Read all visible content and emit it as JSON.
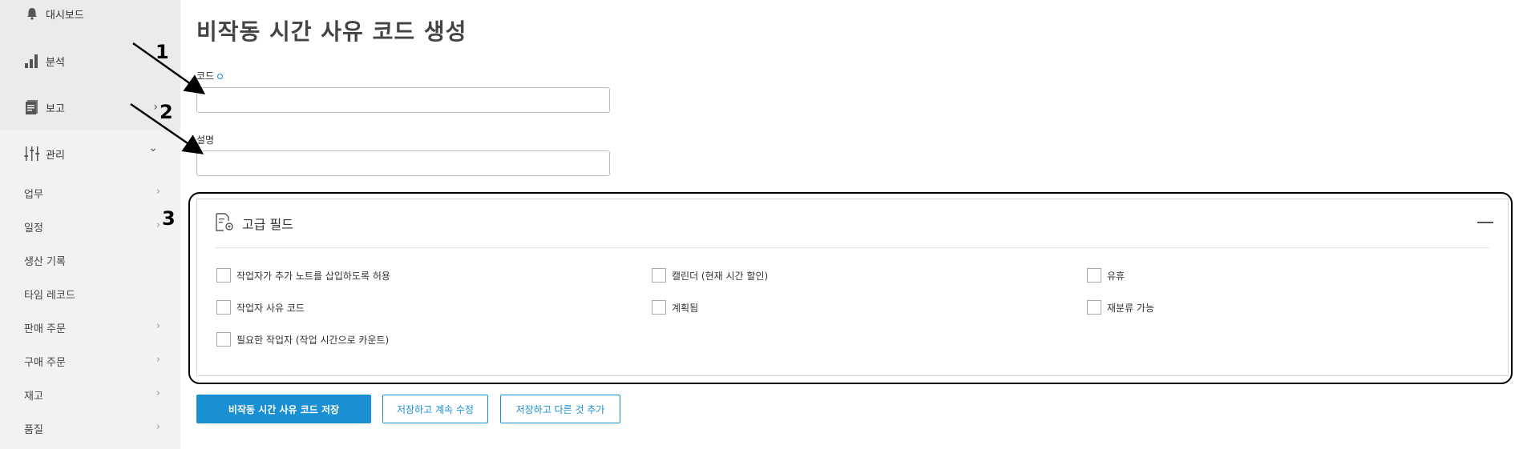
{
  "sidebar": {
    "items": [
      {
        "label": "대시보드",
        "icon": "bell-icon"
      },
      {
        "label": "분석",
        "icon": "bar-chart-icon"
      },
      {
        "label": "보고",
        "icon": "report-icon"
      },
      {
        "label": "관리",
        "icon": "sliders-icon"
      }
    ],
    "sub_items": [
      {
        "label": "업무",
        "chevron": "›"
      },
      {
        "label": "일정",
        "chevron": "›"
      },
      {
        "label": "생산 기록",
        "chevron": ""
      },
      {
        "label": "타임 레코드",
        "chevron": ""
      },
      {
        "label": "판매 주문",
        "chevron": "›"
      },
      {
        "label": "구매 주문",
        "chevron": "›"
      },
      {
        "label": "재고",
        "chevron": "›"
      },
      {
        "label": "품질",
        "chevron": "›"
      }
    ],
    "chevron_report": "›",
    "chevron_manage": "⌄"
  },
  "page": {
    "title": "비작동 시간 사유 코드 생성"
  },
  "form": {
    "code_label": "코드",
    "code_value": "",
    "description_label": "설명",
    "description_value": ""
  },
  "advanced": {
    "title": "고급 필드",
    "collapse_icon": "minus-icon",
    "checkboxes": [
      "작업자가 추가 노트를 삽입하도록 허용",
      "캘린더 (현재 시간 할인)",
      "유휴",
      "작업자 사유 코드",
      "계획됨",
      "재분류 가능",
      "필요한 작업자 (작업 시간으로 카운트)"
    ]
  },
  "buttons": {
    "save": "비작동 시간 사유 코드 저장",
    "save_continue": "저장하고 계속 수정",
    "save_add": "저장하고 다른 것 추가"
  },
  "annotations": [
    "1",
    "2",
    "3"
  ],
  "colors": {
    "accent": "#1a8fd3",
    "sidebar_bg": "#f2f2f2"
  }
}
